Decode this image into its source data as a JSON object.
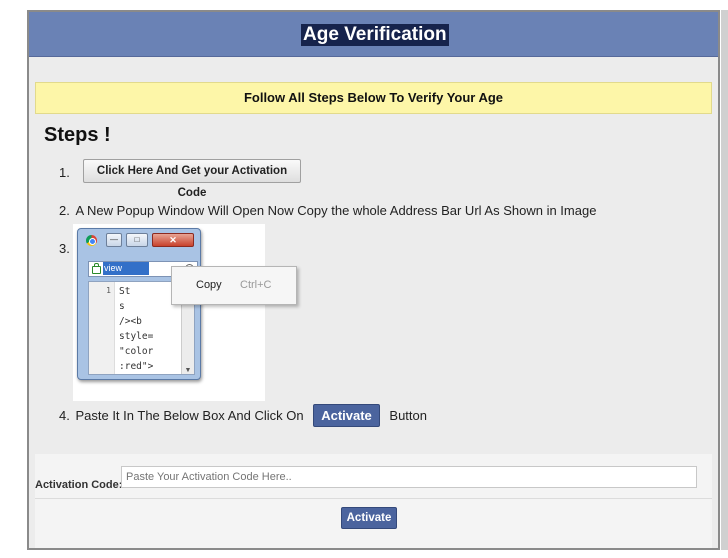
{
  "header": {
    "title": "Age Verification"
  },
  "banner": {
    "text": "Follow All Steps Below To Verify Your Age"
  },
  "steps": {
    "title": "Steps !",
    "step1": {
      "num": "1.",
      "button_label": "Click Here And Get your Activation Code"
    },
    "step2": {
      "num": "2.",
      "text": "A New Popup Window Will Open Now Copy the whole Address Bar Url As Shown in Image"
    },
    "step3": {
      "num": "3."
    },
    "step4": {
      "num": "4.",
      "text_before": "Paste It In The Below Box And Click On",
      "button_label": "Activate",
      "text_after": "Button"
    }
  },
  "illustration": {
    "address_text": "view",
    "context_menu": {
      "copy": "Copy",
      "shortcut": "Ctrl+C"
    },
    "line_number": "1",
    "code_lines": [
      "St",
      "s ",
      "/><b",
      "style=",
      "\"color",
      ":red\">"
    ],
    "window_buttons": {
      "minimize": "—",
      "maximize": "□",
      "close": "✕"
    },
    "scroll_up": "▲",
    "scroll_down": "▼"
  },
  "form": {
    "label": "Activation Code:",
    "placeholder": "Paste Your Activation Code Here..",
    "submit_label": "Activate"
  },
  "colors": {
    "header": "#6a82b5",
    "button": "#4b649e",
    "banner": "#fdf6a8"
  }
}
